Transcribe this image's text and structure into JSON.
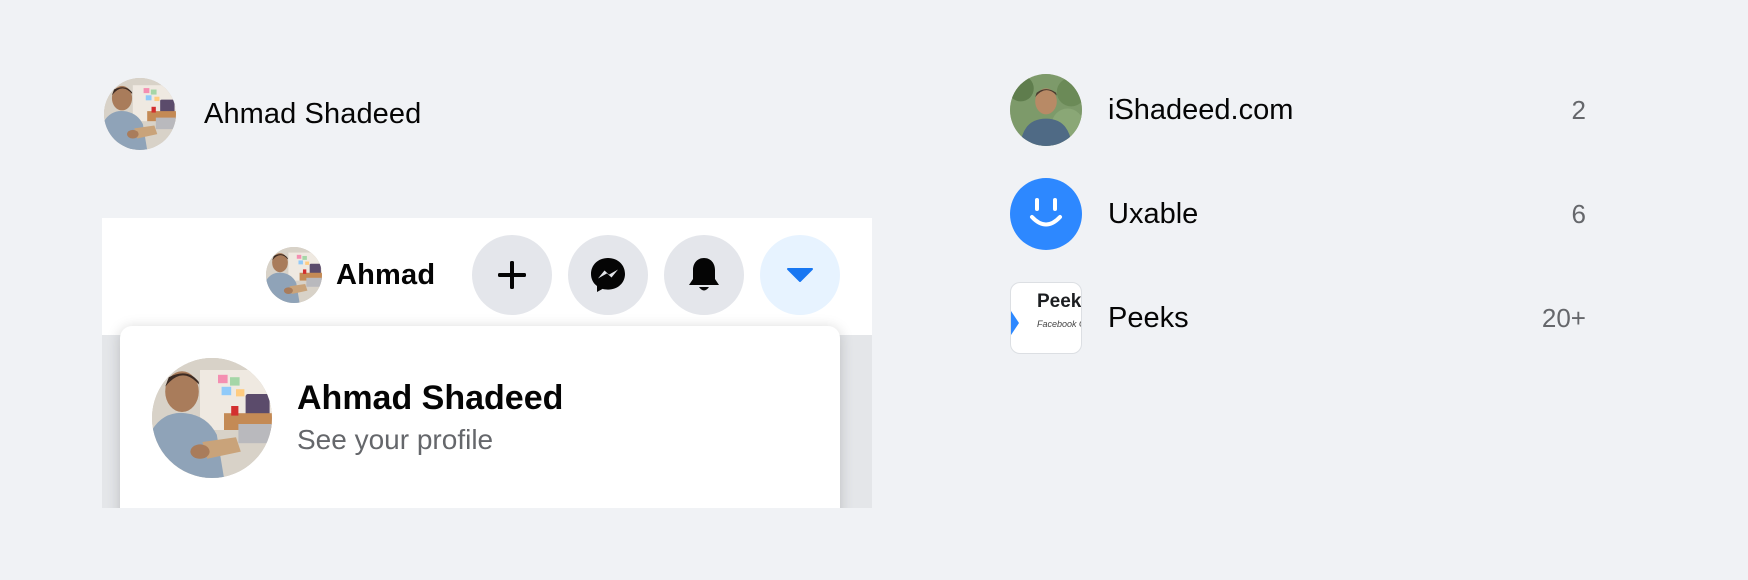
{
  "profile_row": {
    "name": "Ahmad Shadeed"
  },
  "header": {
    "user_name": "Ahmad",
    "buttons": [
      {
        "icon": "plus-icon"
      },
      {
        "icon": "messenger-icon"
      },
      {
        "icon": "bell-icon"
      },
      {
        "icon": "caret-down-icon"
      }
    ]
  },
  "dropdown": {
    "name": "Ahmad Shadeed",
    "subtitle": "See your profile"
  },
  "pages": [
    {
      "label": "iShadeed.com",
      "count": "2"
    },
    {
      "label": "Uxable",
      "count": "6"
    },
    {
      "label": "Peeks",
      "count": "20+",
      "thumb_title": "Peeks",
      "thumb_subtitle": "Facebook G"
    }
  ],
  "colors": {
    "background": "#f0f2f5",
    "accent_blue": "#1877f2",
    "uxable_blue": "#2d88ff",
    "button_gray": "#e4e6eb",
    "active_button_bg": "#e7f3ff",
    "secondary_text": "#65676b"
  }
}
